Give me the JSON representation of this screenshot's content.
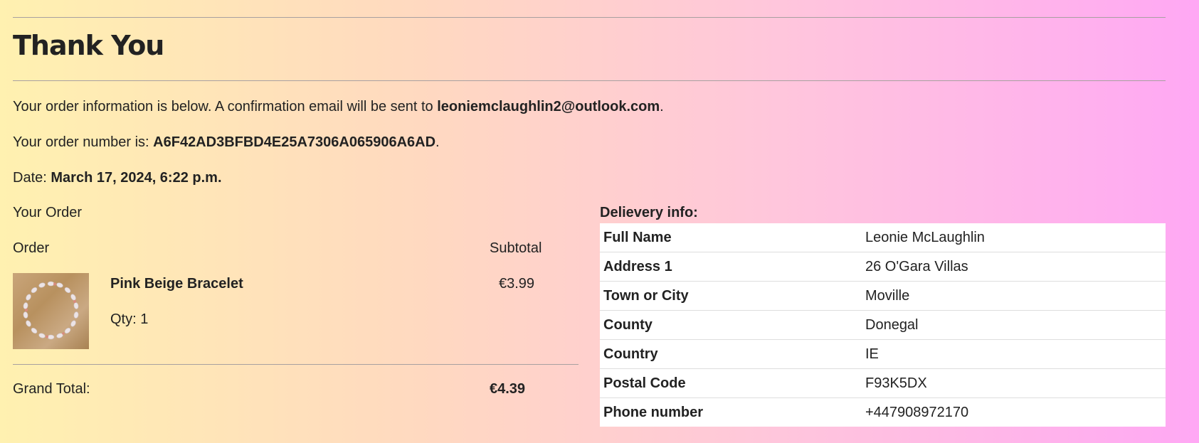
{
  "page": {
    "title": "Thank You"
  },
  "confirmation": {
    "intro_text": "Your order information is below. A confirmation email will be sent to",
    "email": "leoniemclaughlin2@outlook.com",
    "email_suffix": ".",
    "order_number_label": "Your order number is:",
    "order_number": "A6F42AD3BFBD4E25A7306A065906A6AD",
    "order_number_suffix": ".",
    "date_label": "Date:",
    "date": "March 17, 2024, 6:22 p.m."
  },
  "order": {
    "heading": "Your Order",
    "col_order": "Order",
    "col_subtotal": "Subtotal",
    "items": [
      {
        "name": "Pink Beige Bracelet",
        "qty_label": "Qty: 1",
        "price": "€3.99"
      }
    ],
    "grand_total_label": "Grand Total:",
    "grand_total": "€4.39"
  },
  "delivery": {
    "heading": "Delievery info:",
    "rows": [
      {
        "label": "Full Name",
        "value": "Leonie McLaughlin"
      },
      {
        "label": "Address 1",
        "value": "26 O'Gara Villas"
      },
      {
        "label": "Town or City",
        "value": "Moville"
      },
      {
        "label": "County",
        "value": "Donegal"
      },
      {
        "label": "Country",
        "value": "IE"
      },
      {
        "label": "Postal Code",
        "value": "F93K5DX"
      },
      {
        "label": "Phone number",
        "value": "+447908972170"
      }
    ]
  }
}
